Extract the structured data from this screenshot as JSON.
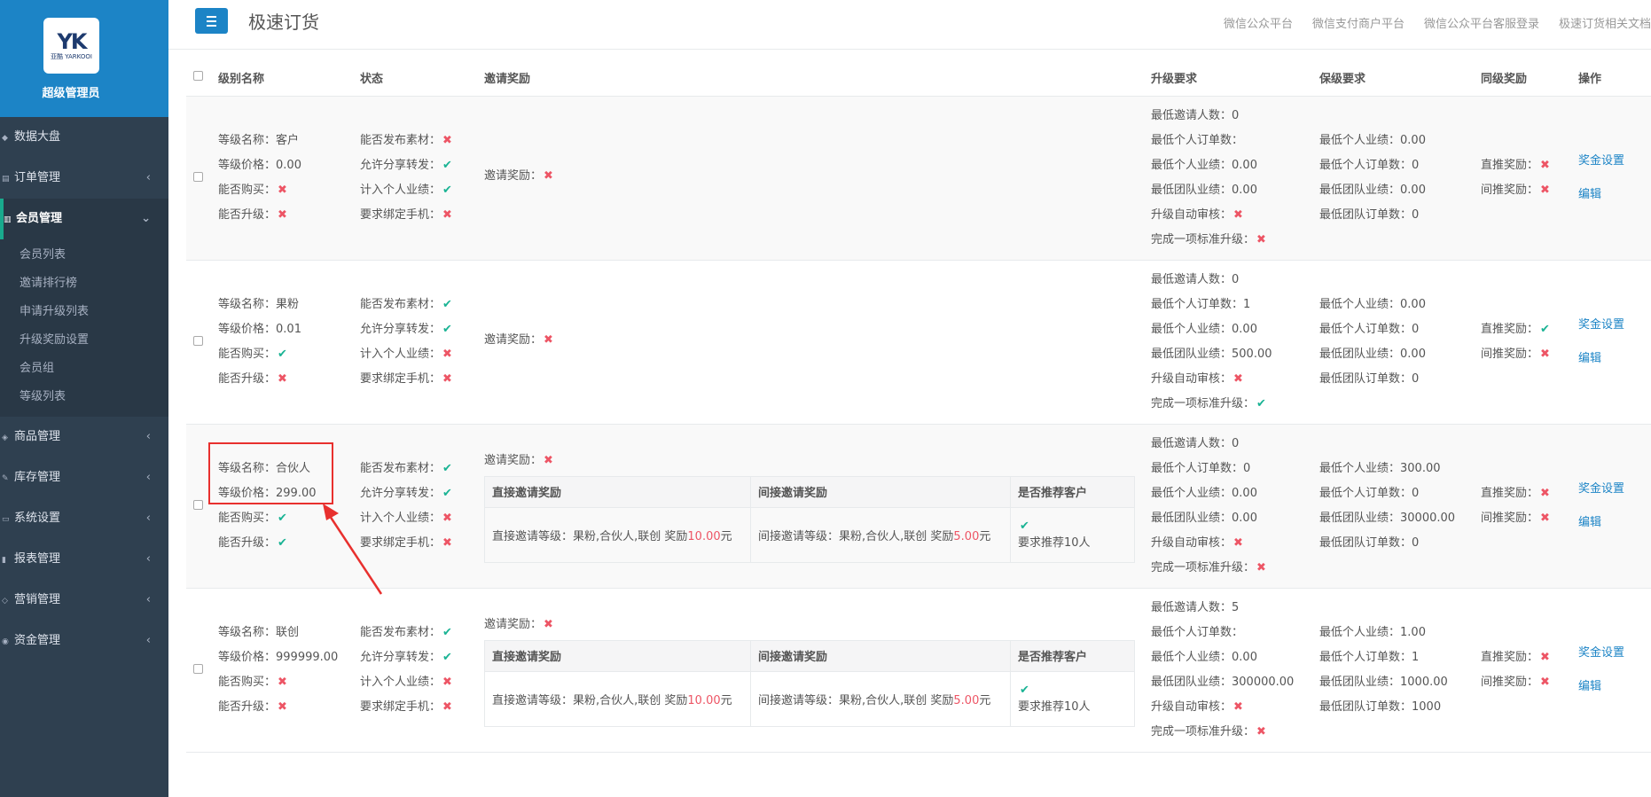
{
  "brand": {
    "logo_text": "YK",
    "logo_sub": "亚酷 YARKOOI",
    "role": "超级管理员"
  },
  "sidebar": {
    "items": [
      {
        "label": "数据大盘",
        "icon": "dashboard-icon",
        "expanded": false,
        "has_chevron": false
      },
      {
        "label": "订单管理",
        "icon": "order-icon",
        "expanded": false,
        "has_chevron": true
      },
      {
        "label": "会员管理",
        "icon": "chart-icon",
        "expanded": true,
        "has_chevron": true
      },
      {
        "label": "商品管理",
        "icon": "shopping-icon",
        "expanded": false,
        "has_chevron": true
      },
      {
        "label": "库存管理",
        "icon": "edit-icon",
        "expanded": false,
        "has_chevron": true
      },
      {
        "label": "系统设置",
        "icon": "desktop-icon",
        "expanded": false,
        "has_chevron": true
      },
      {
        "label": "报表管理",
        "icon": "bar-chart-icon",
        "expanded": false,
        "has_chevron": true
      },
      {
        "label": "营销管理",
        "icon": "tag-icon",
        "expanded": false,
        "has_chevron": true
      },
      {
        "label": "资金管理",
        "icon": "money-icon",
        "expanded": false,
        "has_chevron": true
      }
    ],
    "member_sub": [
      "会员列表",
      "邀请排行榜",
      "申请升级列表",
      "升级奖励设置",
      "会员组",
      "等级列表"
    ]
  },
  "topbar": {
    "title": "极速订货",
    "links": [
      "微信公众平台",
      "微信支付商户平台",
      "微信公众平台客服登录",
      "极速订货相关文档"
    ]
  },
  "table": {
    "headers": {
      "name": "级别名称",
      "status": "状态",
      "invite": "邀请奖励",
      "upgrade": "升级要求",
      "keep": "保级要求",
      "same": "同级奖励",
      "action": "操作"
    },
    "inner_headers": {
      "direct": "直接邀请奖励",
      "indirect": "间接邀请奖励",
      "recommend": "是否推荐客户"
    },
    "labels": {
      "level_name": "等级名称：",
      "level_price": "等级价格：",
      "can_buy": "能否购买：",
      "can_upgrade": "能否升级：",
      "can_publish": "能否发布素材：",
      "allow_share": "允许分享转发：",
      "count_personal": "计入个人业绩：",
      "bind_phone": "要求绑定手机：",
      "invite_reward": "邀请奖励：",
      "min_invite": "最低邀请人数：",
      "min_personal_orders": "最低个人订单数：",
      "min_personal_perf": "最低个人业绩：",
      "min_team_perf": "最低团队业绩：",
      "auto_review": "升级自动审核：",
      "one_std": "完成一项标准升级：",
      "keep_personal_perf": "最低个人业绩：",
      "keep_personal_orders": "最低个人订单数：",
      "keep_team_perf": "最低团队业绩：",
      "keep_team_orders": "最低团队订单数：",
      "direct_reward": "直推奖励：",
      "indirect_reward": "间推奖励："
    },
    "actions": {
      "reward": "奖金设置",
      "edit": "编辑"
    },
    "rows": [
      {
        "name": "客户",
        "price": "0.00",
        "can_buy": false,
        "can_upgrade": false,
        "can_publish": false,
        "allow_share": true,
        "count_personal": true,
        "bind_phone": false,
        "invite_reward": false,
        "has_inner": false,
        "min_invite": "0",
        "min_personal_orders": "",
        "min_personal_perf": "0.00",
        "min_team_perf": "0.00",
        "auto_review": false,
        "one_std": false,
        "keep_personal_perf": "0.00",
        "keep_personal_orders": "0",
        "keep_team_perf": "0.00",
        "keep_team_orders": "0",
        "direct_reward": false,
        "indirect_reward": false
      },
      {
        "name": "果粉",
        "price": "0.01",
        "can_buy": true,
        "can_upgrade": false,
        "can_publish": true,
        "allow_share": true,
        "count_personal": false,
        "bind_phone": false,
        "invite_reward": false,
        "has_inner": false,
        "min_invite": "0",
        "min_personal_orders": "1",
        "min_personal_perf": "0.00",
        "min_team_perf": "500.00",
        "auto_review": false,
        "one_std": true,
        "keep_personal_perf": "0.00",
        "keep_personal_orders": "0",
        "keep_team_perf": "0.00",
        "keep_team_orders": "0",
        "direct_reward": true,
        "indirect_reward": false
      },
      {
        "name": "合伙人",
        "price": "299.00",
        "can_buy": true,
        "can_upgrade": true,
        "can_publish": true,
        "allow_share": true,
        "count_personal": false,
        "bind_phone": false,
        "invite_reward": false,
        "has_inner": true,
        "inner": {
          "direct_prefix": "直接邀请等级：果粉,合伙人,联创 奖励",
          "direct_amount": "10.00",
          "direct_unit": "元",
          "indirect_prefix": "间接邀请等级：果粉,合伙人,联创 奖励",
          "indirect_amount": "5.00",
          "indirect_unit": "元",
          "recommend_ok": true,
          "recommend_text": "要求推荐10人"
        },
        "min_invite": "0",
        "min_personal_orders": "0",
        "min_personal_perf": "0.00",
        "min_team_perf": "0.00",
        "auto_review": false,
        "one_std": false,
        "keep_personal_perf": "300.00",
        "keep_personal_orders": "0",
        "keep_team_perf": "30000.00",
        "keep_team_orders": "0",
        "direct_reward": false,
        "indirect_reward": false
      },
      {
        "name": "联创",
        "price": "999999.00",
        "can_buy": false,
        "can_upgrade": false,
        "can_publish": true,
        "allow_share": true,
        "count_personal": false,
        "bind_phone": false,
        "invite_reward": false,
        "has_inner": true,
        "inner": {
          "direct_prefix": "直接邀请等级：果粉,合伙人,联创 奖励",
          "direct_amount": "10.00",
          "direct_unit": "元",
          "indirect_prefix": "间接邀请等级：果粉,合伙人,联创 奖励",
          "indirect_amount": "5.00",
          "indirect_unit": "元",
          "recommend_ok": true,
          "recommend_text": "要求推荐10人"
        },
        "min_invite": "5",
        "min_personal_orders": "",
        "min_personal_perf": "0.00",
        "min_team_perf": "300000.00",
        "auto_review": false,
        "one_std": false,
        "keep_personal_perf": "1.00",
        "keep_personal_orders": "1",
        "keep_team_perf": "1000.00",
        "keep_team_orders": "1000",
        "direct_reward": false,
        "indirect_reward": false
      }
    ]
  },
  "colors": {
    "sidebar_bg": "#2f4050",
    "brand_bg": "#1c84c6",
    "ok": "#1ab394",
    "no": "#ed5565",
    "link": "#1c84c6",
    "annotation": "#e8302e"
  }
}
